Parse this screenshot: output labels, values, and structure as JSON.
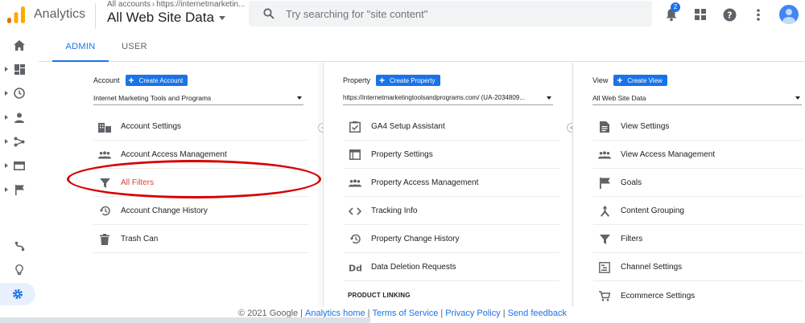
{
  "header": {
    "app_name": "Analytics",
    "account_crumb": "All accounts",
    "property_crumb": "https://internetmarketin...",
    "view_name": "All Web Site Data",
    "search_placeholder": "Try searching for \"site content\"",
    "notification_count": "2"
  },
  "tabs": [
    {
      "label": "ADMIN",
      "active": true
    },
    {
      "label": "USER",
      "active": false
    }
  ],
  "account": {
    "label": "Account",
    "create_label": "Create Account",
    "selected": "Internet Marketing Tools and Programs",
    "items": [
      {
        "label": "Account Settings",
        "icon": "building-icon"
      },
      {
        "label": "Account Access Management",
        "icon": "people-icon"
      },
      {
        "label": "All Filters",
        "icon": "filter-icon",
        "highlighted": true
      },
      {
        "label": "Account Change History",
        "icon": "history-icon"
      },
      {
        "label": "Trash Can",
        "icon": "trash-icon"
      }
    ]
  },
  "property": {
    "label": "Property",
    "create_label": "Create Property",
    "selected": "https://internetmarketingtoolsandprograms.com/ (UA-2034809...",
    "items": [
      {
        "label": "GA4 Setup Assistant",
        "icon": "checklist-icon"
      },
      {
        "label": "Property Settings",
        "icon": "settings-window-icon"
      },
      {
        "label": "Property Access Management",
        "icon": "people-icon"
      },
      {
        "label": "Tracking Info",
        "icon": "code-icon"
      },
      {
        "label": "Property Change History",
        "icon": "history-icon"
      },
      {
        "label": "Data Deletion Requests",
        "icon": "dd-icon"
      }
    ],
    "section_label": "PRODUCT LINKING"
  },
  "view": {
    "label": "View",
    "create_label": "Create View",
    "selected": "All Web Site Data",
    "items": [
      {
        "label": "View Settings",
        "icon": "document-icon"
      },
      {
        "label": "View Access Management",
        "icon": "people-icon"
      },
      {
        "label": "Goals",
        "icon": "flag-icon"
      },
      {
        "label": "Content Grouping",
        "icon": "grouping-icon"
      },
      {
        "label": "Filters",
        "icon": "filter-icon"
      },
      {
        "label": "Channel Settings",
        "icon": "channel-icon"
      },
      {
        "label": "Ecommerce Settings",
        "icon": "cart-icon"
      }
    ]
  },
  "footer": {
    "copyright": "© 2021 Google",
    "links": [
      "Analytics home",
      "Terms of Service",
      "Privacy Policy",
      "Send feedback"
    ]
  },
  "colors": {
    "accent": "#1a73e8",
    "highlight_text": "#db4437",
    "annotation": "#d60000",
    "logo_orange": "#f9ab00",
    "logo_dark_orange": "#e37400"
  }
}
